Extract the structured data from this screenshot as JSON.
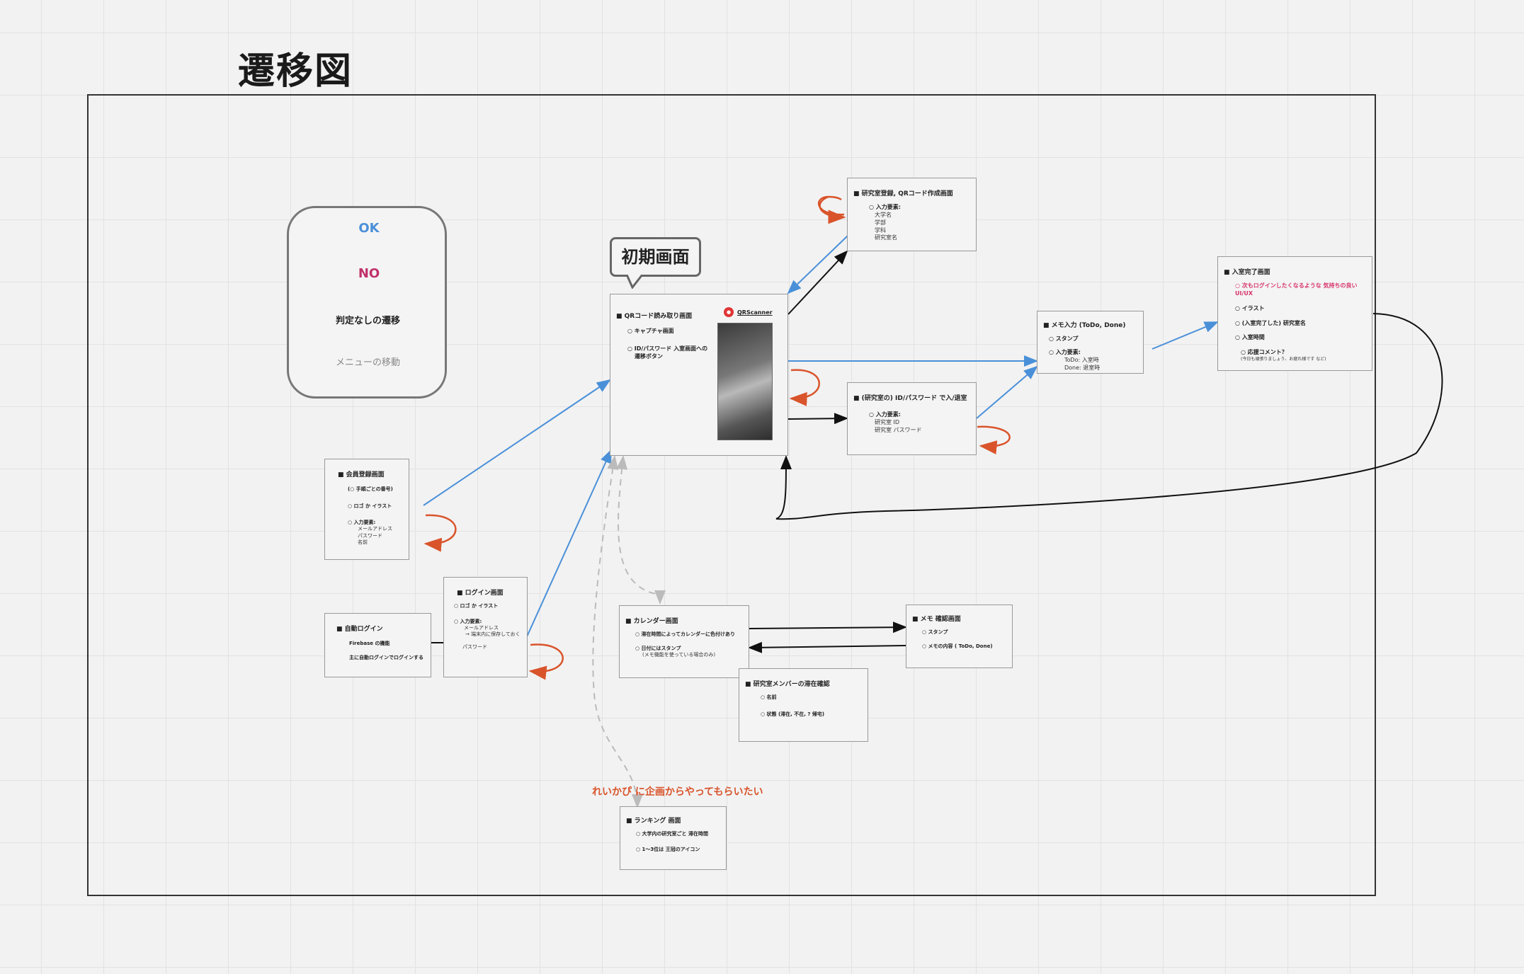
{
  "title": "遷移図",
  "legend": {
    "ok": "OK",
    "no": "NO",
    "none": "判定なしの遷移",
    "menu": "メニューの移動"
  },
  "colors": {
    "ok": "#4a90d9",
    "no": "#d9542b",
    "neutral": "#111111",
    "menu": "#bbbbbb"
  },
  "bubble": "初期画面",
  "qr_app": {
    "name": "QRScanner"
  },
  "screens": {
    "qr": {
      "header": "■ QRコード読み取り画面",
      "items": [
        "○ キャプチャ画面",
        "○ ID/パスワード 入室画面への",
        "遷移ボタン"
      ]
    },
    "lab_register": {
      "header": "■ 研究室登録, QRコード作成画面",
      "items": [
        "○ 入力要素:"
      ],
      "subs": [
        "大学名",
        "学部",
        "学科",
        "研究室名"
      ]
    },
    "memo_input": {
      "header": "■ メモ入力 (ToDo, Done)",
      "items": [
        "○ スタンプ",
        "○ 入力要素:"
      ],
      "subs": [
        "ToDo: 入室時",
        "Done: 退室時"
      ]
    },
    "id_pass": {
      "header": "■ (研究室の) ID/パスワード で入/退室",
      "items": [
        "○ 入力要素:"
      ],
      "subs": [
        "研究室 ID",
        "研究室 パスワード"
      ]
    },
    "entry_done": {
      "header": "■ 入室完了画面",
      "items": [
        "○ 次もログインしたくなるような 気持ちの良い UI/UX",
        "○ イラスト",
        "○ (入室完了した) 研究室名",
        "○ 入室時間",
        "○ 応援コメント？"
      ],
      "subs": [
        "(今日も頑張りましょう、お疲れ様です など)"
      ]
    },
    "member_register": {
      "header": "■ 会員登録画面",
      "items": [
        "(○ 手順ごとの番号)",
        "○ ロゴ か イラスト",
        "○ 入力要素:"
      ],
      "subs": [
        "メールアドレス",
        "パスワード",
        "名前"
      ]
    },
    "auto_login": {
      "header": "■ 自動ログイン",
      "items": [
        "Firebase の機能",
        "主に自動ログインでログインする"
      ]
    },
    "login": {
      "header": "■ ログイン画面",
      "items": [
        "○ ロゴ か イラスト",
        "○ 入力要素:"
      ],
      "subs": [
        "メールアドレス",
        "→ 端末内に保存しておく",
        "パスワード"
      ]
    },
    "calendar": {
      "header": "■ カレンダー画面",
      "items": [
        "○ 滞在時間によってカレンダーに色付けあり",
        "○ 日付にはスタンプ"
      ],
      "subs": [
        "(メモ機能を使っている場合のみ)"
      ]
    },
    "memo_confirm": {
      "header": "■ メモ 確認画面",
      "items": [
        "○ スタンプ",
        "○ メモの内容 ( ToDo, Done)"
      ]
    },
    "member_status": {
      "header": "■ 研究室メンバーの滞在確認",
      "items": [
        "○ 名前",
        "○ 状態 (滞在, 不在, ? 帰宅)"
      ]
    },
    "ranking": {
      "header": "■ ランキング 画面",
      "items": [
        "○ 大学内の研究室ごと 滞在時間",
        "○ 1〜3位は 王冠のアイコン"
      ]
    }
  },
  "note": "れいかぴ に企画からやってもらいたい"
}
